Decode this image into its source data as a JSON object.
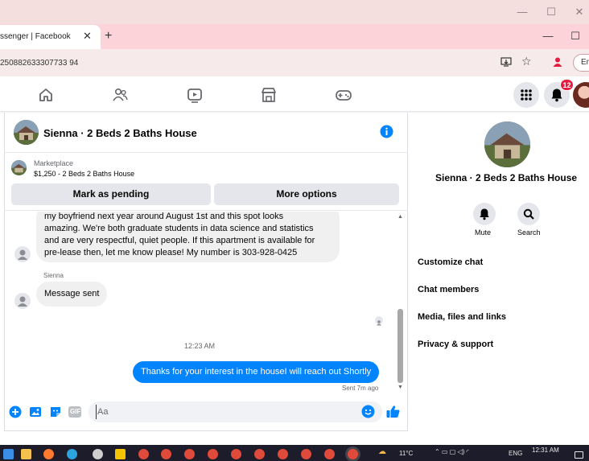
{
  "browser": {
    "tab_title": "ssenger | Facebook",
    "tab_close": "✕",
    "new_tab": "+",
    "url": "250882633307733 94",
    "profile_label": "Em",
    "window_controls": [
      "—",
      "☐",
      "✕"
    ],
    "inner_controls": [
      "—",
      "☐"
    ]
  },
  "fb_nav": {
    "notification_count": "12",
    "icons": [
      "home-icon",
      "friends-icon",
      "watch-icon",
      "marketplace-icon",
      "gaming-icon",
      "menu-grid-icon",
      "bell-icon",
      "profile-avatar"
    ]
  },
  "conversation": {
    "title": "Sienna · 2 Beds 2 Baths House",
    "listing": {
      "source": "Marketplace",
      "summary": "$1,250 - 2 Beds 2 Baths House"
    },
    "buttons": {
      "pending": "Mark as pending",
      "more": "More options"
    },
    "messages": {
      "long_text_lines": [
        "my boyfriend next year around August 1st and this spot looks",
        "amazing. We're both graduate students in data science and statistics",
        "and are very respectful, quiet people. If this apartment is available for",
        "pre-lease then, let me know please! My number is 303-928-0425"
      ],
      "sender_name": "Sienna",
      "short_text": "Message sent",
      "timestamp": "12:23 AM",
      "outgoing_text": "Thanks for your interest in the houseI will reach out Shortly",
      "sent_status": "Sent 7m ago"
    },
    "composer": {
      "placeholder": "Aa"
    }
  },
  "info_panel": {
    "title": "Sienna · 2 Beds 2 Baths House",
    "mute_label": "Mute",
    "search_label": "Search",
    "menu": [
      "Customize chat",
      "Chat members",
      "Media, files and links",
      "Privacy & support"
    ]
  },
  "taskbar": {
    "weather": "11°C",
    "language": "ENG",
    "time": "12:31 AM"
  },
  "colors": {
    "messenger_blue": "#0084ff",
    "fb_blue": "#1877f2",
    "notification_red": "#e41e3f"
  }
}
